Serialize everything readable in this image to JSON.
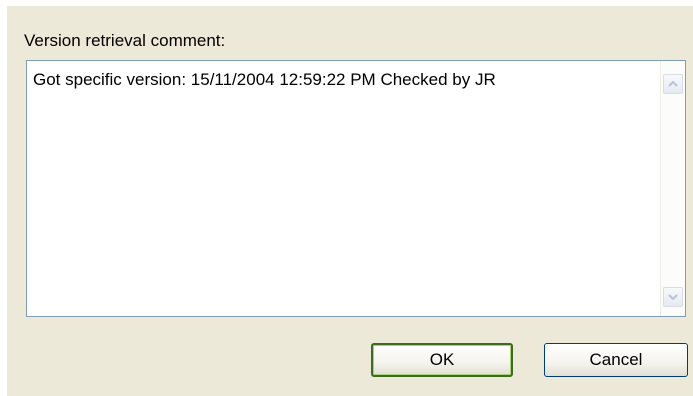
{
  "dialog": {
    "comment_label": "Version retrieval comment:",
    "comment_text": "Got specific version: 15/11/2004 12:59:22 PM Checked by JR",
    "buttons": {
      "ok_label": "OK",
      "cancel_label": "Cancel"
    },
    "icons": {
      "scroll_up": "chevron-up-icon",
      "scroll_down": "chevron-down-icon"
    },
    "colors": {
      "dialog_background": "#ece9d8",
      "textbox_border": "#7f9db9",
      "ok_border": "#3c6b1f",
      "cancel_border": "#003c74"
    }
  }
}
